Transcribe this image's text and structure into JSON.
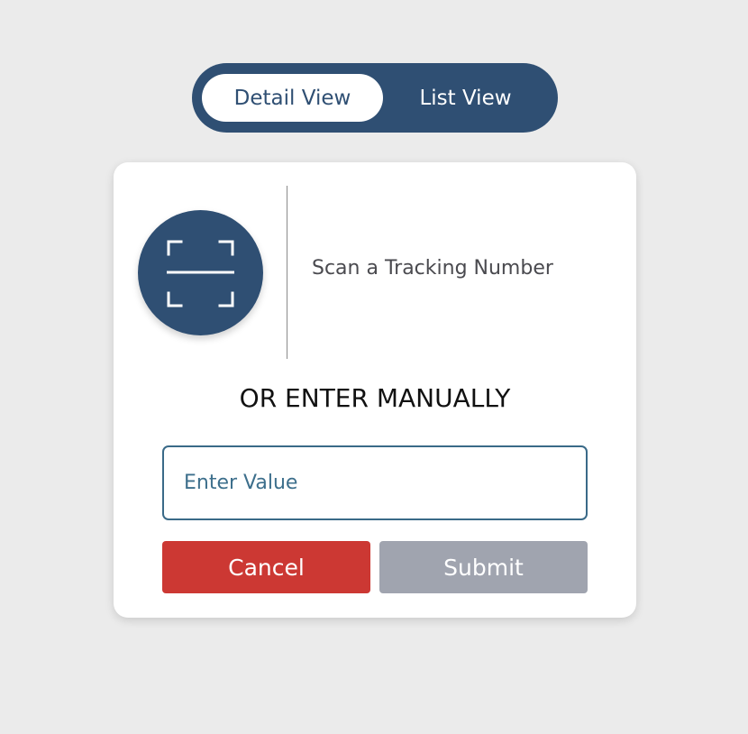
{
  "view_toggle": {
    "detail_label": "Detail View",
    "list_label": "List View",
    "active": "Detail View"
  },
  "scan": {
    "icon": "scan-frame-icon",
    "label": "Scan a Tracking Number"
  },
  "manual": {
    "heading": "OR ENTER MANUALLY",
    "input_value": "",
    "input_placeholder": "Enter Value"
  },
  "actions": {
    "cancel_label": "Cancel",
    "submit_label": "Submit"
  },
  "colors": {
    "brand": "#2f4f73",
    "cancel": "#cc3833",
    "submit_disabled": "#a0a4af",
    "input_border": "#3a6a88",
    "background": "#ebebeb"
  }
}
